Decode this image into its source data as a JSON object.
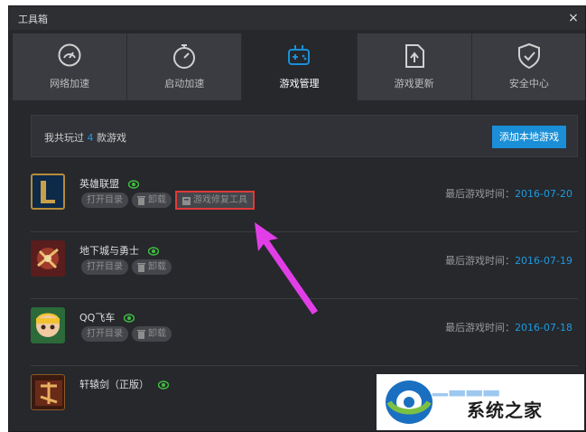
{
  "window": {
    "title": "工具箱",
    "close_glyph": "×"
  },
  "tabs": [
    {
      "label": "网络加速",
      "icon": "speedometer-icon",
      "active": false
    },
    {
      "label": "启动加速",
      "icon": "stopwatch-icon",
      "active": false
    },
    {
      "label": "游戏管理",
      "icon": "gamepad-icon",
      "active": true
    },
    {
      "label": "游戏更新",
      "icon": "upload-file-icon",
      "active": false
    },
    {
      "label": "安全中心",
      "icon": "shield-check-icon",
      "active": false
    }
  ],
  "summary": {
    "prefix": "我共玩过",
    "count": "4",
    "suffix": "款游戏",
    "add_button": "添加本地游戏"
  },
  "games": [
    {
      "name": "英雄联盟",
      "open_dir": "打开目录",
      "uninstall": "卸载",
      "repair": "游戏修复工具",
      "last_label": "最后游戏时间：",
      "last_date": "2016-07-20"
    },
    {
      "name": "地下城与勇士",
      "open_dir": "打开目录",
      "uninstall": "卸载",
      "last_label": "最后游戏时间：",
      "last_date": "2016-07-19"
    },
    {
      "name": "QQ飞车",
      "open_dir": "打开目录",
      "uninstall": "卸载",
      "last_label": "最后游戏时间：",
      "last_date": "2016-07-18"
    },
    {
      "name": "轩辕剑（正版）"
    }
  ],
  "watermark": {
    "text": "系统之家"
  },
  "colors": {
    "accent": "#1a8fd8",
    "highlight": "#e03a3a",
    "arrow": "#e23ee8",
    "eye": "#3fbf3f"
  }
}
